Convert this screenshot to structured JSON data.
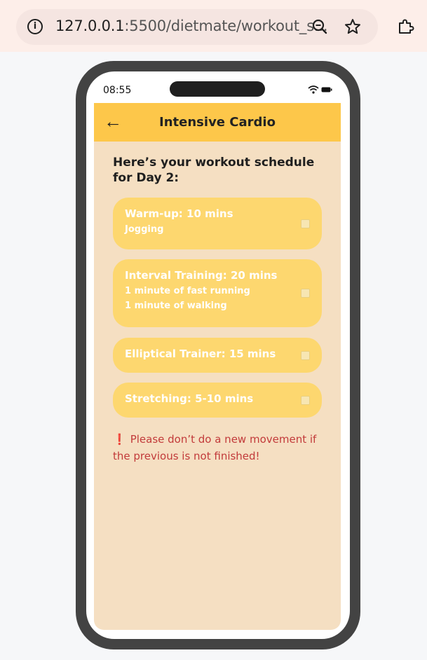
{
  "browser": {
    "url_host": "127.0.0.1",
    "url_rest": ":5500/dietmate/workout_s..."
  },
  "status_bar": {
    "time": "08:55"
  },
  "app": {
    "title": "Intensive Cardio",
    "back_label": "←",
    "intro": "Here’s your workout schedule for Day 2:",
    "exercises": [
      {
        "title": "Warm-up: 10 mins",
        "details": [
          "Jogging"
        ],
        "checked": false
      },
      {
        "title": "Interval Training: 20 mins",
        "details": [
          "1 minute of fast running",
          "1 minute of walking"
        ],
        "checked": false
      },
      {
        "title": "Elliptical Trainer: 15 mins",
        "details": [],
        "checked": false
      },
      {
        "title": "Stretching: 5-10 mins",
        "details": [],
        "checked": false
      }
    ],
    "warning_icon": "❗",
    "warning": "Please don’t do a new movement if the previous is not finished!"
  },
  "colors": {
    "header": "#fdc74a",
    "background": "#f5dfc2",
    "card": "#fdd76f",
    "warning": "#c23a3a"
  }
}
